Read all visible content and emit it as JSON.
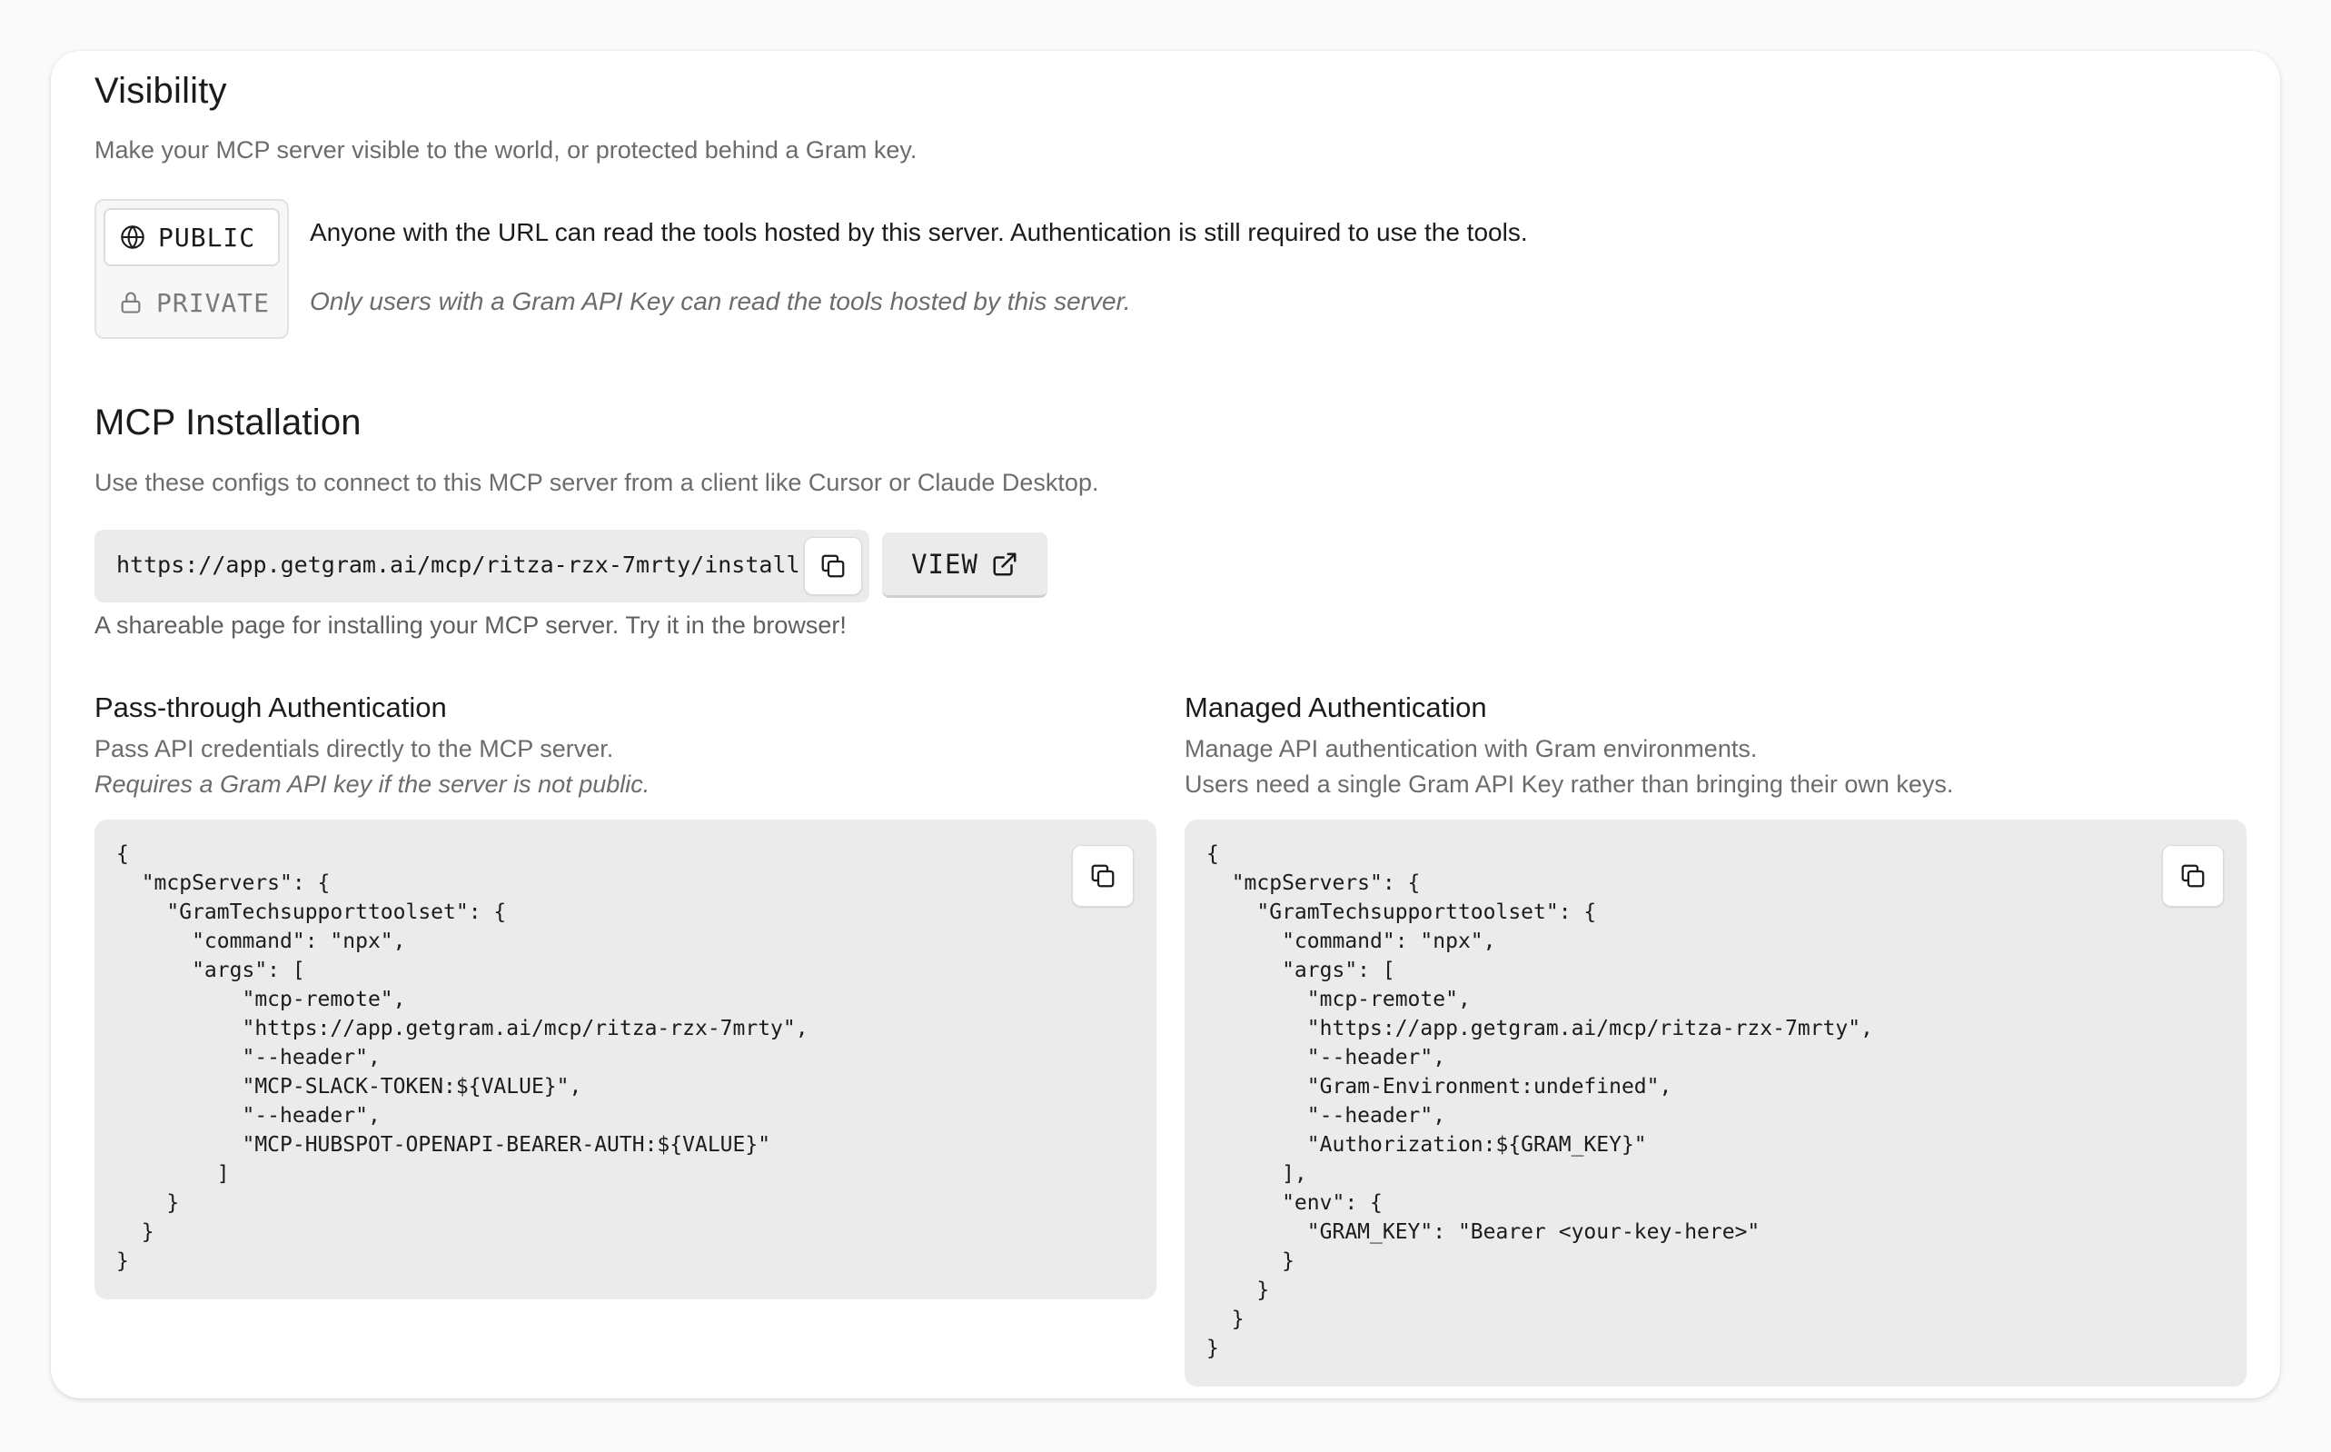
{
  "visibility": {
    "title": "Visibility",
    "subtitle": "Make your MCP server visible to the world, or protected behind a Gram key.",
    "options": [
      {
        "label": "PUBLIC",
        "icon": "globe-icon",
        "selected": true
      },
      {
        "label": "PRIVATE",
        "icon": "lock-icon",
        "selected": false
      }
    ],
    "public_description": "Anyone with the URL can read the tools hosted by this server. Authentication is still required to use the tools.",
    "private_description": "Only users with a Gram API Key can read the tools hosted by this server."
  },
  "installation": {
    "title": "MCP Installation",
    "subtitle": "Use these configs to connect to this MCP server from a client like Cursor or Claude Desktop.",
    "install_url": "https://app.getgram.ai/mcp/ritza-rzx-7mrty/install",
    "view_label": "VIEW",
    "hint": "A shareable page for installing your MCP server. Try it in the browser!"
  },
  "passthrough": {
    "title": "Pass-through Authentication",
    "description": "Pass API credentials directly to the MCP server.",
    "note": "Requires a Gram API key if the server is not public.",
    "config": "{\n  \"mcpServers\": {\n    \"GramTechsupporttoolset\": {\n      \"command\": \"npx\",\n      \"args\": [\n          \"mcp-remote\",\n          \"https://app.getgram.ai/mcp/ritza-rzx-7mrty\",\n          \"--header\",\n          \"MCP-SLACK-TOKEN:${VALUE}\",\n          \"--header\",\n          \"MCP-HUBSPOT-OPENAPI-BEARER-AUTH:${VALUE}\"\n        ]\n    }\n  }\n}"
  },
  "managed": {
    "title": "Managed Authentication",
    "description": "Manage API authentication with Gram environments.",
    "note": "Users need a single Gram API Key rather than bringing their own keys.",
    "config": "{\n  \"mcpServers\": {\n    \"GramTechsupporttoolset\": {\n      \"command\": \"npx\",\n      \"args\": [\n        \"mcp-remote\",\n        \"https://app.getgram.ai/mcp/ritza-rzx-7mrty\",\n        \"--header\",\n        \"Gram-Environment:undefined\",\n        \"--header\",\n        \"Authorization:${GRAM_KEY}\"\n      ],\n      \"env\": {\n        \"GRAM_KEY\": \"Bearer <your-key-here>\"\n      }\n    }\n  }\n}"
  },
  "icons": {
    "copy": "copy-icon",
    "external": "external-link-icon"
  }
}
